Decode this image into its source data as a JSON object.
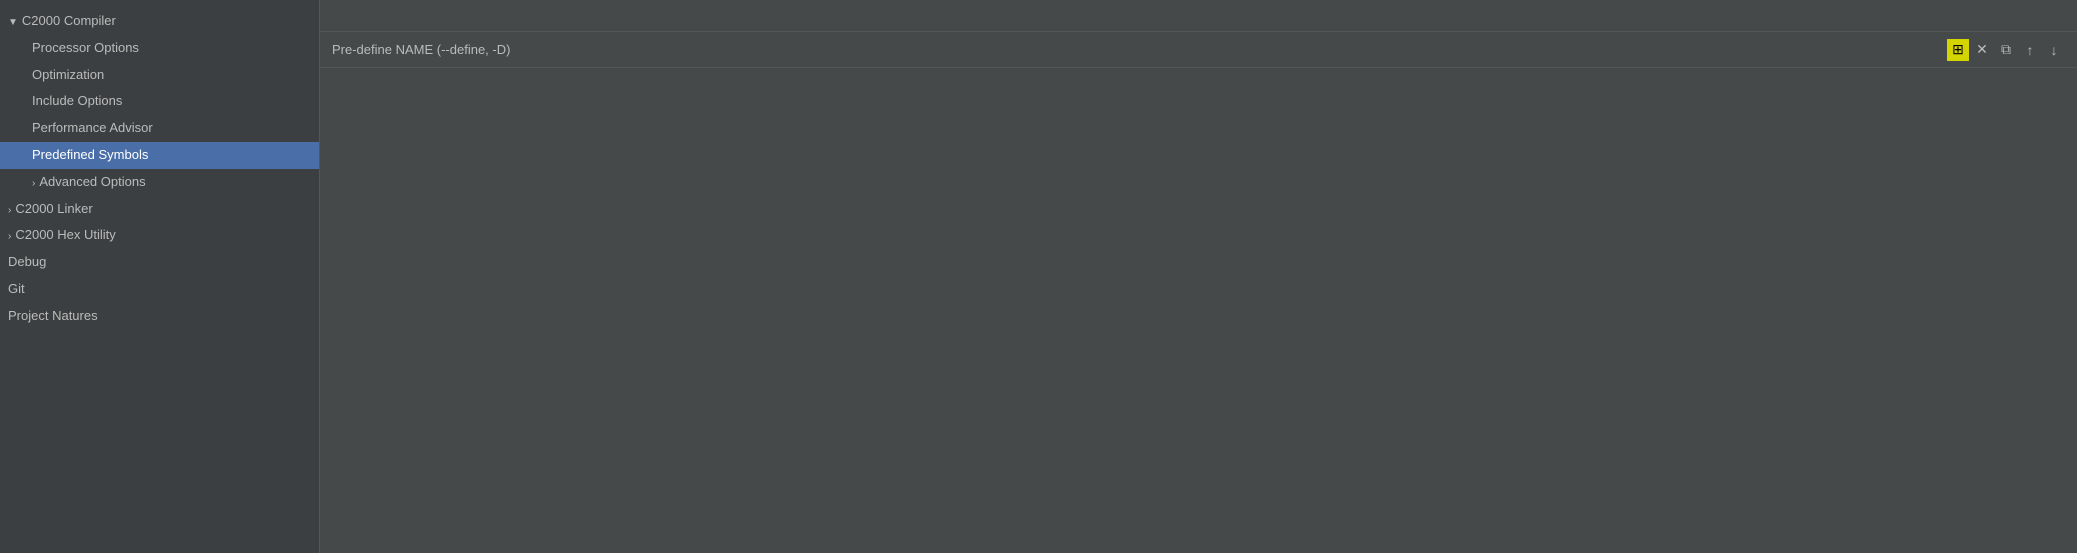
{
  "sidebar": {
    "items": [
      {
        "id": "c2000-compiler",
        "label": "C2000 Compiler",
        "level": 0,
        "expanded": true,
        "arrow": "▼"
      },
      {
        "id": "processor-options",
        "label": "Processor Options",
        "level": 1,
        "expanded": false,
        "arrow": ""
      },
      {
        "id": "optimization",
        "label": "Optimization",
        "level": 1,
        "expanded": false,
        "arrow": ""
      },
      {
        "id": "include-options",
        "label": "Include Options",
        "level": 1,
        "expanded": false,
        "arrow": ""
      },
      {
        "id": "performance-advisor",
        "label": "Performance Advisor",
        "level": 1,
        "expanded": false,
        "arrow": ""
      },
      {
        "id": "predefined-symbols",
        "label": "Predefined Symbols",
        "level": 1,
        "expanded": false,
        "arrow": "",
        "selected": true
      },
      {
        "id": "advanced-options",
        "label": "Advanced Options",
        "level": 1,
        "expanded": false,
        "arrow": "›"
      },
      {
        "id": "c2000-linker",
        "label": "C2000 Linker",
        "level": 0,
        "expanded": false,
        "arrow": "›"
      },
      {
        "id": "c2000-hex-utility",
        "label": "C2000 Hex Utility",
        "level": 0,
        "expanded": false,
        "arrow": "›"
      },
      {
        "id": "debug",
        "label": "Debug",
        "level": 0,
        "expanded": false,
        "arrow": ""
      },
      {
        "id": "git",
        "label": "Git",
        "level": 0,
        "expanded": false,
        "arrow": ""
      },
      {
        "id": "project-natures",
        "label": "Project Natures",
        "level": 0,
        "expanded": false,
        "arrow": ""
      }
    ]
  },
  "main": {
    "panel_title": "Pre-define NAME (--define, -D)",
    "toolbar": {
      "add_btn": "add-icon",
      "add_label": "⊞",
      "delete_btn": "delete-icon",
      "delete_label": "✕",
      "copy_btn": "copy-icon",
      "copy_label": "⧉",
      "move_up_btn": "move-up-icon",
      "move_up_label": "↑",
      "move_down_btn": "move-down-icon",
      "move_down_label": "↓"
    }
  }
}
